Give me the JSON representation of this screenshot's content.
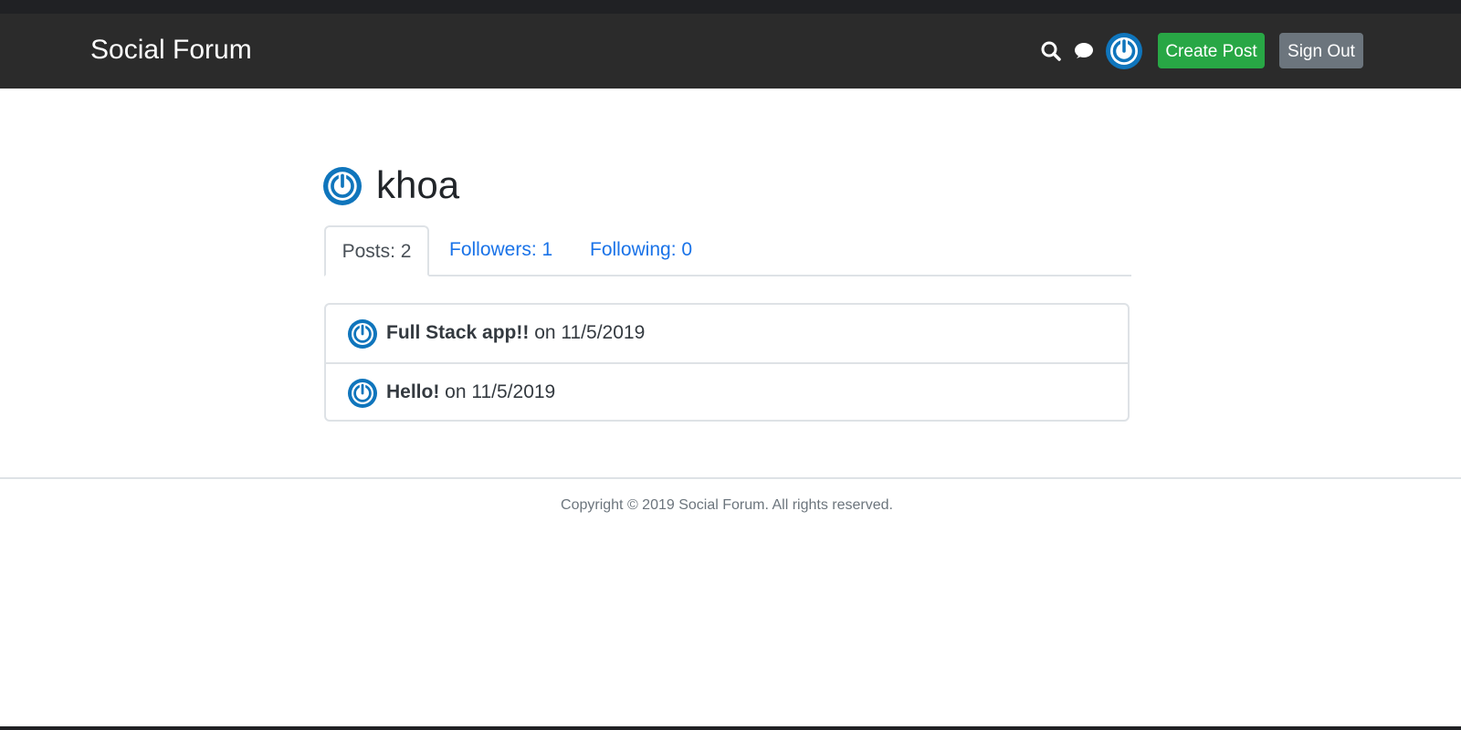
{
  "navbar": {
    "brand": "Social Forum",
    "create_post_label": "Create Post",
    "sign_out_label": "Sign Out",
    "icons": [
      "search-icon",
      "chat-icon",
      "avatar-icon"
    ]
  },
  "profile": {
    "username": "khoa",
    "tabs": [
      {
        "label": "Posts: 2",
        "active": true
      },
      {
        "label": "Followers: 1",
        "active": false
      },
      {
        "label": "Following: 0",
        "active": false
      }
    ],
    "posts": [
      {
        "title": "Full Stack app!!",
        "suffix": " on 11/5/2019"
      },
      {
        "title": "Hello!",
        "suffix": " on 11/5/2019"
      }
    ]
  },
  "footer": {
    "copyright": "Copyright © 2019 Social Forum. All rights reserved."
  },
  "colors": {
    "navbar_bg": "#2b2b2b",
    "accent_blue": "#1a73e8",
    "avatar_blue": "#0f75bc",
    "create_green": "#28a745",
    "signout_gray": "#6c757d"
  }
}
